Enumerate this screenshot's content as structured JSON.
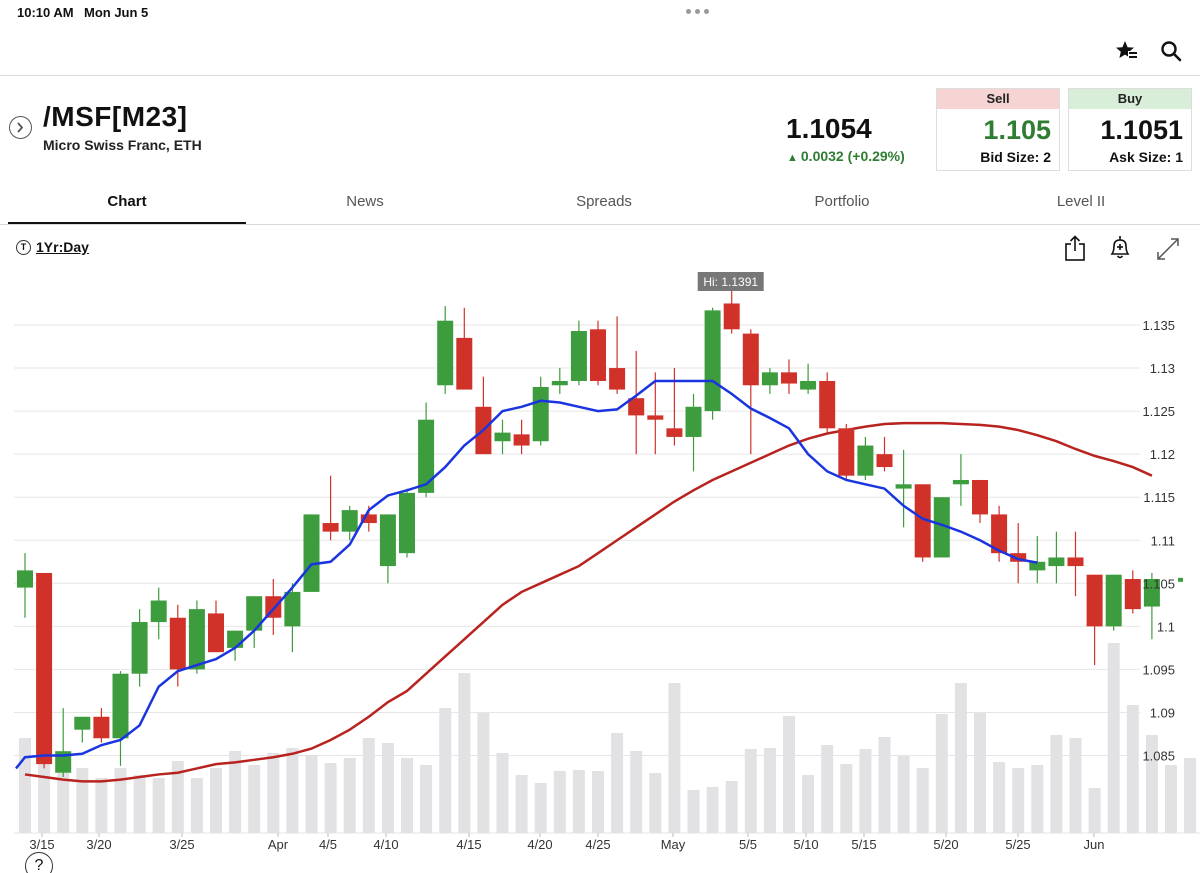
{
  "status": {
    "time": "10:10 AM",
    "date": "Mon Jun 5"
  },
  "toolbar": {
    "watchlist_icon": "star-add-icon",
    "search_icon": "search-icon"
  },
  "instrument": {
    "symbol": "/MSF[M23]",
    "description": "Micro Swiss Franc, ETH",
    "last": "1.1054",
    "change": "0.0032 (+0.29%)",
    "change_color": "#2e7d32"
  },
  "quote": {
    "sell_label": "Sell",
    "bid": "1.105",
    "bid_size": "Bid Size: 2",
    "buy_label": "Buy",
    "ask": "1.1051",
    "ask_size": "Ask Size: 1"
  },
  "tabs": [
    {
      "label": "Chart",
      "active": true
    },
    {
      "label": "News"
    },
    {
      "label": "Spreads"
    },
    {
      "label": "Portfolio"
    },
    {
      "label": "Level II"
    }
  ],
  "chart_controls": {
    "timeframe": "1Yr:Day",
    "share_icon": "share-icon",
    "alert_icon": "bell-plus-icon",
    "fullscreen_icon": "expand-icon"
  },
  "help": "?",
  "chart_data": {
    "type": "candlestick",
    "hi_label": "Hi: 1.1391",
    "y_ticks": [
      "1.135",
      "1.13",
      "1.125",
      "1.12",
      "1.115",
      "1.11",
      "1.105",
      "1.1",
      "1.095",
      "1.09",
      "1.085"
    ],
    "x_ticks": [
      "3/15",
      "3/20",
      "3/25",
      "Apr",
      "4/5",
      "4/10",
      "4/15",
      "4/20",
      "4/25",
      "May",
      "5/5",
      "5/10",
      "5/15",
      "5/20",
      "5/25",
      "Jun"
    ],
    "ylim": [
      1.078,
      1.142
    ],
    "colors": {
      "up": "#3d9c3d",
      "down": "#d0322a",
      "ema_fast": "#1a35e0",
      "sma_slow": "#b8231f",
      "volume": "#e2e2e4"
    },
    "candles": [
      [
        1.1045,
        1.1085,
        1.101,
        1.1065
      ],
      [
        1.1062,
        1.1062,
        1.0835,
        1.084
      ],
      [
        1.083,
        1.0905,
        1.0825,
        1.0855
      ],
      [
        1.088,
        1.0895,
        1.0865,
        1.0895
      ],
      [
        1.0895,
        1.0905,
        1.0865,
        1.087
      ],
      [
        1.087,
        1.0948,
        1.0838,
        1.0945
      ],
      [
        1.0945,
        1.102,
        1.093,
        1.1005
      ],
      [
        1.1005,
        1.1045,
        1.0985,
        1.103
      ],
      [
        1.101,
        1.1025,
        1.093,
        1.095
      ],
      [
        1.095,
        1.103,
        1.0945,
        1.102
      ],
      [
        1.1015,
        1.103,
        1.097,
        1.097
      ],
      [
        1.0975,
        1.0995,
        1.096,
        1.0995
      ],
      [
        1.0995,
        1.1035,
        1.0975,
        1.1035
      ],
      [
        1.1035,
        1.1055,
        1.099,
        1.101
      ],
      [
        1.1,
        1.105,
        1.097,
        1.104
      ],
      [
        1.104,
        1.113,
        1.104,
        1.113
      ],
      [
        1.112,
        1.1175,
        1.11,
        1.111
      ],
      [
        1.111,
        1.114,
        1.11,
        1.1135
      ],
      [
        1.113,
        1.114,
        1.111,
        1.112
      ],
      [
        1.107,
        1.113,
        1.105,
        1.113
      ],
      [
        1.1085,
        1.116,
        1.108,
        1.1155
      ],
      [
        1.1155,
        1.126,
        1.115,
        1.124
      ],
      [
        1.128,
        1.1372,
        1.127,
        1.1355
      ],
      [
        1.1335,
        1.137,
        1.1275,
        1.1275
      ],
      [
        1.1255,
        1.129,
        1.12,
        1.12
      ],
      [
        1.1215,
        1.124,
        1.12,
        1.1225
      ],
      [
        1.1223,
        1.124,
        1.12,
        1.121
      ],
      [
        1.1215,
        1.129,
        1.121,
        1.1278
      ],
      [
        1.128,
        1.13,
        1.127,
        1.1285
      ],
      [
        1.1285,
        1.1355,
        1.128,
        1.1343
      ],
      [
        1.1345,
        1.1355,
        1.128,
        1.1285
      ],
      [
        1.13,
        1.136,
        1.127,
        1.1275
      ],
      [
        1.1265,
        1.132,
        1.12,
        1.1245
      ],
      [
        1.1245,
        1.1295,
        1.12,
        1.124
      ],
      [
        1.123,
        1.13,
        1.121,
        1.122
      ],
      [
        1.122,
        1.127,
        1.118,
        1.1255
      ],
      [
        1.125,
        1.137,
        1.124,
        1.1367
      ],
      [
        1.1375,
        1.1391,
        1.134,
        1.1345
      ],
      [
        1.134,
        1.1345,
        1.12,
        1.128
      ],
      [
        1.128,
        1.13,
        1.127,
        1.1295
      ],
      [
        1.1295,
        1.131,
        1.127,
        1.1282
      ],
      [
        1.1275,
        1.1305,
        1.127,
        1.1285
      ],
      [
        1.1285,
        1.1295,
        1.1225,
        1.123
      ],
      [
        1.123,
        1.1235,
        1.117,
        1.1175
      ],
      [
        1.1175,
        1.122,
        1.117,
        1.121
      ],
      [
        1.12,
        1.122,
        1.118,
        1.1185
      ],
      [
        1.116,
        1.1205,
        1.1115,
        1.1165
      ],
      [
        1.1165,
        1.1165,
        1.1075,
        1.108
      ],
      [
        1.108,
        1.115,
        1.108,
        1.115
      ],
      [
        1.1165,
        1.12,
        1.114,
        1.117
      ],
      [
        1.117,
        1.117,
        1.112,
        1.113
      ],
      [
        1.113,
        1.114,
        1.1075,
        1.1085
      ],
      [
        1.1085,
        1.112,
        1.105,
        1.1075
      ],
      [
        1.1065,
        1.1105,
        1.105,
        1.1075
      ],
      [
        1.107,
        1.111,
        1.105,
        1.108
      ],
      [
        1.108,
        1.111,
        1.1035,
        1.107
      ],
      [
        1.106,
        1.106,
        1.0955,
        1.1
      ],
      [
        1.1,
        1.106,
        1.0995,
        1.106
      ],
      [
        1.1055,
        1.1065,
        1.1015,
        1.102
      ],
      [
        1.1023,
        1.1062,
        1.0985,
        1.1055
      ]
    ],
    "ema_fast": [
      1.0848,
      1.085,
      1.085,
      1.0852,
      1.0862,
      1.0868,
      1.0885,
      1.093,
      1.0948,
      1.0955,
      1.0962,
      1.0975,
      1.0995,
      1.102,
      1.1045,
      1.1072,
      1.1075,
      1.1095,
      1.1135,
      1.1152,
      1.1158,
      1.1165,
      1.1185,
      1.121,
      1.1228,
      1.125,
      1.1255,
      1.1262,
      1.126,
      1.1255,
      1.125,
      1.1252,
      1.1268,
      1.1285,
      1.1285,
      1.1285,
      1.1285,
      1.127,
      1.1253,
      1.1242,
      1.123,
      1.12,
      1.118,
      1.117,
      1.1165,
      1.116,
      1.114,
      1.1125,
      1.1118,
      1.111,
      1.11,
      1.1088,
      1.1078,
      1.1074
    ],
    "sma_slow": [
      1.0828,
      1.0825,
      1.0822,
      1.082,
      1.082,
      1.0822,
      1.0825,
      1.0828,
      1.083,
      1.0835,
      1.084,
      1.0842,
      1.0845,
      1.0848,
      1.0852,
      1.0858,
      1.0868,
      1.088,
      1.0895,
      1.0912,
      1.0925,
      1.0945,
      1.0965,
      1.0985,
      1.1005,
      1.1025,
      1.104,
      1.105,
      1.106,
      1.107,
      1.1085,
      1.11,
      1.1115,
      1.113,
      1.1145,
      1.1158,
      1.117,
      1.118,
      1.119,
      1.12,
      1.121,
      1.1218,
      1.1224,
      1.1228,
      1.1232,
      1.1235,
      1.1236,
      1.1236,
      1.1236,
      1.1235,
      1.1234,
      1.1232,
      1.1228,
      1.1222,
      1.1215,
      1.1206,
      1.1198,
      1.1192,
      1.1185,
      1.1175
    ],
    "volume": [
      95,
      145,
      75,
      65,
      55,
      65,
      58,
      55,
      72,
      55,
      65,
      82,
      68,
      80,
      85,
      78,
      70,
      75,
      95,
      90,
      75,
      68,
      125,
      160,
      120,
      80,
      58,
      50,
      62,
      63,
      62,
      100,
      82,
      60,
      150,
      43,
      46,
      52,
      84,
      85,
      117,
      58,
      88,
      69,
      84,
      96,
      77,
      65,
      119,
      150,
      120,
      71,
      65,
      68,
      98,
      95,
      45,
      190,
      128,
      98,
      68,
      75
    ],
    "last_marker": 1.1054
  }
}
